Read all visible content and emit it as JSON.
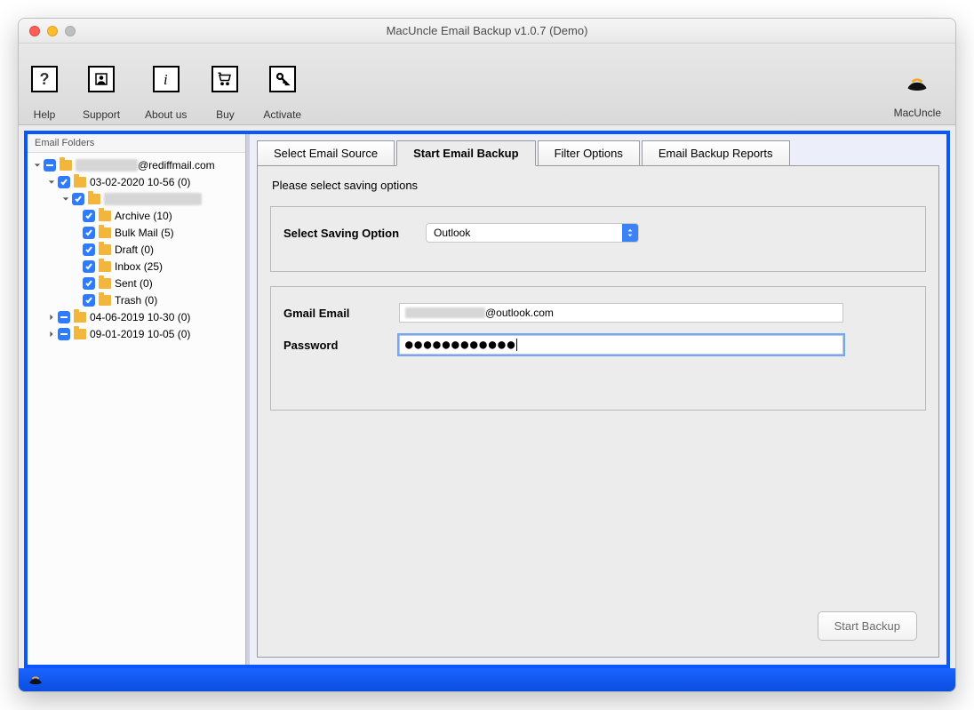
{
  "window": {
    "title": "MacUncle Email Backup v1.0.7 (Demo)"
  },
  "toolbar": {
    "help": "Help",
    "support": "Support",
    "about": "About us",
    "buy": "Buy",
    "activate": "Activate",
    "brand": "MacUncle"
  },
  "sidebar": {
    "title": "Email Folders",
    "root_suffix": "@rediffmail.com",
    "nodes": [
      {
        "label": "03-02-2020 10-56 (0)"
      },
      {
        "label": "Archive (10)"
      },
      {
        "label": "Bulk Mail (5)"
      },
      {
        "label": "Draft (0)"
      },
      {
        "label": "Inbox (25)"
      },
      {
        "label": "Sent (0)"
      },
      {
        "label": "Trash (0)"
      },
      {
        "label": "04-06-2019 10-30 (0)"
      },
      {
        "label": "09-01-2019 10-05 (0)"
      }
    ]
  },
  "tabs": {
    "source": "Select Email Source",
    "start": "Start Email Backup",
    "filter": "Filter Options",
    "reports": "Email Backup Reports"
  },
  "form": {
    "instruction": "Please select saving options",
    "saving_label": "Select Saving Option",
    "saving_value": "Outlook",
    "email_label": "Gmail Email",
    "email_suffix": "@outlook.com",
    "password_label": "Password",
    "password_value": "●●●●●●●●●●●●",
    "start_button": "Start Backup"
  }
}
